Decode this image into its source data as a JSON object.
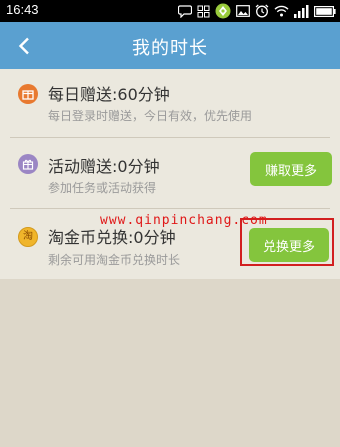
{
  "status_bar": {
    "time": "16:43",
    "icons": [
      "chat-icon",
      "grid-icon",
      "app-icon",
      "image-icon",
      "alarm-icon",
      "wifi-icon",
      "signal-icon",
      "battery-icon"
    ]
  },
  "header": {
    "title": "我的时长",
    "back_icon": "chevron-left-icon"
  },
  "rows": [
    {
      "title": "每日赠送:60分钟",
      "subtitle": "每日登录时赠送，今日有效，优先使用",
      "icon": "gift-box-icon",
      "icon_color": "#e8792f"
    },
    {
      "title": "活动赠送:0分钟",
      "subtitle": "参加任务或活动获得",
      "icon": "present-icon",
      "icon_color": "#9b86c4",
      "button": "赚取更多"
    },
    {
      "title": "淘金币兑换:0分钟",
      "subtitle": "剩余可用淘金币兑换时长",
      "icon": "gold-coin-icon",
      "icon_label": "淘",
      "icon_color": "#f0b52b",
      "button": "兑换更多"
    }
  ],
  "watermark": "www.qinpinchang.com",
  "colors": {
    "title_bar": "#5aa0d0",
    "button": "#84c53d",
    "highlight": "#d21f1f",
    "background": "#ddd7c9",
    "card": "#ebe8de"
  }
}
